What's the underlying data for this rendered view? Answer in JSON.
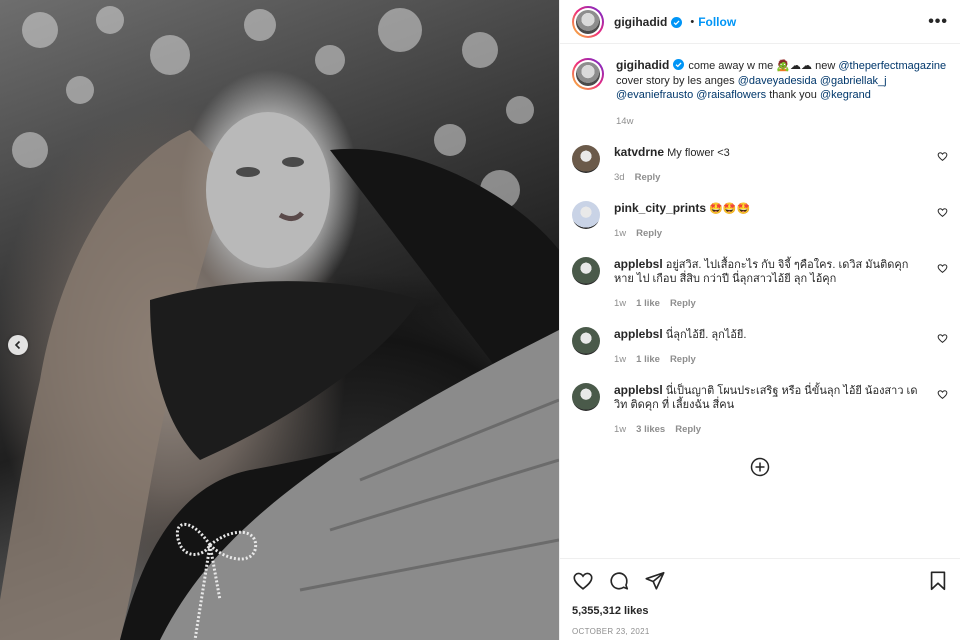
{
  "post": {
    "username": "gigihadid",
    "follow_label": "Follow",
    "more_label": "•••",
    "caption_text": "come away w me 🧟☁☁ new",
    "caption_mention_1": "@theperfectmagazine",
    "caption_mid": "cover story by les anges",
    "caption_mention_2": "@daveyadesida",
    "caption_mention_3": "@gabriellak_j",
    "caption_mention_4": "@evaniefrausto",
    "caption_mention_5": "@raisaflowers",
    "caption_thanks": "thank you",
    "caption_mention_6": "@kegrand",
    "caption_time": "14w",
    "likes": "5,355,312 likes",
    "date": "OCTOBER 23, 2021"
  },
  "comments": [
    {
      "user": "katvdrne",
      "text": "My flower <3",
      "time": "3d",
      "likes": "",
      "reply": "Reply",
      "avatar_color": "#6b5a4a"
    },
    {
      "user": "pink_city_prints",
      "text": "🤩🤩🤩",
      "time": "1w",
      "likes": "",
      "reply": "Reply",
      "avatar_color": "#c9d3e6"
    },
    {
      "user": "applebsl",
      "text": "อยู่สวิส. ไปเสื้อกะไร กับ จิจี้ ๆคือใคร. เดวิส มันติดคุก หาย ไป เกือบ สี่สิบ กว่าปี นี่ลุกสาวไอ้ยี ลุก ไอ้คุก",
      "time": "1w",
      "likes": "1 like",
      "reply": "Reply",
      "avatar_color": "#4a5a4a"
    },
    {
      "user": "applebsl",
      "text": "นี่ลุกไอ้ยี. ลุกไอ้ยี.",
      "time": "1w",
      "likes": "1 like",
      "reply": "Reply",
      "avatar_color": "#4a5a4a"
    },
    {
      "user": "applebsl",
      "text": "นี่เป็นญาติ โผนประเสริฐ หรือ นี่ขั้นลุก ไอ้ยี น้องสาว เดวิท ติดคุก ที่ เลี้ยงฉัน สี่คน",
      "time": "1w",
      "likes": "3 likes",
      "reply": "Reply",
      "avatar_color": "#4a5a4a"
    }
  ],
  "icons": {
    "heart": "heart-icon",
    "comment": "comment-icon",
    "share": "share-icon",
    "save": "bookmark-icon",
    "add": "plus-circle-icon",
    "verified": "verified-badge-icon",
    "carousel_prev": "chevron-left-icon"
  },
  "colors": {
    "accent": "#0095f6",
    "link": "#00376b",
    "muted": "#8e8e8e"
  }
}
